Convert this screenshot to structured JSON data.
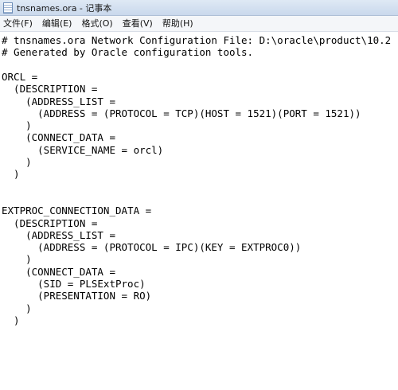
{
  "window": {
    "title": "tnsnames.ora - 记事本",
    "icon": "notepad-icon"
  },
  "menu": [
    {
      "label": "文件(F)"
    },
    {
      "label": "编辑(E)"
    },
    {
      "label": "格式(O)"
    },
    {
      "label": "查看(V)"
    },
    {
      "label": "帮助(H)"
    }
  ],
  "editor": {
    "lines": [
      "# tnsnames.ora Network Configuration File: D:\\oracle\\product\\10.2",
      "# Generated by Oracle configuration tools.",
      "",
      "ORCL =",
      "  (DESCRIPTION =",
      "    (ADDRESS_LIST =",
      "      (ADDRESS = (PROTOCOL = TCP)(HOST = 1521)(PORT = 1521))",
      "    )",
      "    (CONNECT_DATA =",
      "      (SERVICE_NAME = orcl)",
      "    )",
      "  )",
      "",
      "",
      "EXTPROC_CONNECTION_DATA =",
      "  (DESCRIPTION =",
      "    (ADDRESS_LIST =",
      "      (ADDRESS = (PROTOCOL = IPC)(KEY = EXTPROC0))",
      "    )",
      "    (CONNECT_DATA =",
      "      (SID = PLSExtProc)",
      "      (PRESENTATION = RO)",
      "    )",
      "  )"
    ]
  }
}
